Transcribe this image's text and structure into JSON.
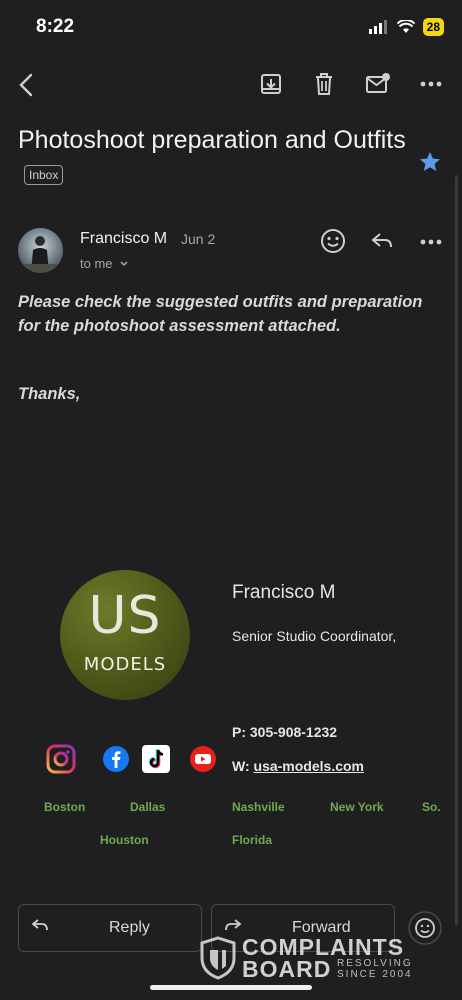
{
  "status_bar": {
    "time": "8:22",
    "battery": "28"
  },
  "toolbar": {
    "back": "back-icon",
    "archive": "archive-icon",
    "delete": "trash-icon",
    "mark_unread": "mail-unread-icon",
    "more": "more-icon"
  },
  "email": {
    "subject": "Photoshoot preparation and Outfits",
    "label": "Inbox",
    "starred": true,
    "sender": "Francisco M",
    "date": "Jun 2",
    "recipient": "to me",
    "body": "Please check the suggested outfits and preparation for the photoshoot assessment attached.",
    "closing": "Thanks,"
  },
  "signature": {
    "logo_top": "US",
    "logo_bottom": "MODELS",
    "name": "Francisco M",
    "title": "Senior Studio Coordinator,",
    "phone_label": "P:",
    "phone": "305-908-1232",
    "web_label": "W:",
    "web": "usa-models.com",
    "social": [
      "instagram-icon",
      "facebook-icon",
      "tiktok-icon",
      "youtube-icon"
    ],
    "cities_row1": [
      "Boston",
      "Dallas",
      "Nashville",
      "New York",
      "So."
    ],
    "cities_row2": [
      "Houston",
      "Florida"
    ]
  },
  "actions": {
    "reply": "Reply",
    "forward": "Forward"
  },
  "watermark": {
    "line1": "COMPLAINTS",
    "line2": "BOARD",
    "tagline1": "RESOLVING",
    "tagline2": "SINCE 2004"
  },
  "colors": {
    "background": "#1f1f22",
    "star": "#5b9be6",
    "city_green": "#6faa4e",
    "battery": "#f5d60a"
  }
}
